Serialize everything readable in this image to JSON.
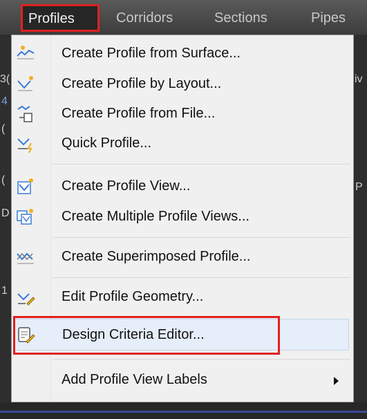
{
  "menubar": {
    "items": [
      "Profiles",
      "Corridors",
      "Sections",
      "Pipes"
    ],
    "active": "Profiles"
  },
  "background_fragments": [
    "3(",
    "4",
    "(",
    "(",
    "iv",
    "P",
    "1",
    "D"
  ],
  "menu": {
    "items": [
      {
        "label": "Create Profile from Surface...",
        "icon": "profile-surface-icon"
      },
      {
        "label": "Create Profile by Layout...",
        "icon": "profile-layout-icon"
      },
      {
        "label": "Create Profile from File...",
        "icon": "profile-file-icon"
      },
      {
        "label": "Quick Profile...",
        "icon": "quick-profile-icon"
      },
      {
        "label": "Create Profile View...",
        "icon": "profile-view-icon"
      },
      {
        "label": "Create Multiple Profile Views...",
        "icon": "multiple-profile-views-icon"
      },
      {
        "label": "Create Superimposed Profile...",
        "icon": "superimposed-profile-icon"
      },
      {
        "label": "Edit Profile Geometry...",
        "icon": "edit-geometry-icon"
      },
      {
        "label": "Design Criteria Editor...",
        "icon": "design-criteria-icon"
      },
      {
        "label": "Add Profile View Labels",
        "icon": "none"
      }
    ]
  },
  "colors": {
    "highlight_box": "#e02020",
    "menu_background": "#f0f0f0",
    "hover_background": "#e5eef9",
    "menubar": "#474747"
  }
}
